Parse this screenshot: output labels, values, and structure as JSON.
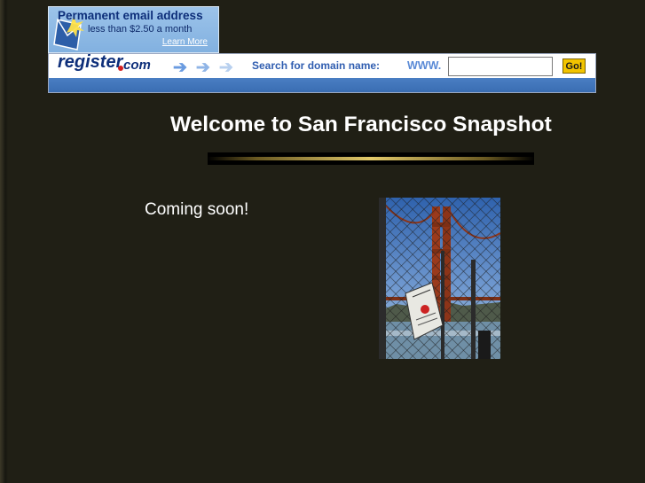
{
  "ad": {
    "title": "Permanent email address",
    "price": "less than $2.50 a month",
    "learn_more": "Learn More",
    "logo_register": "register",
    "logo_com": "com",
    "search_label": "Search for domain name:",
    "www_label": "WWW.",
    "domain_value": "",
    "go_label": "Go!",
    "arrow_glyph": "➔",
    "arrow_colors": [
      "#6a9be0",
      "#8fb4e6",
      "#b8d0ef"
    ]
  },
  "main": {
    "heading": "Welcome to San Francisco Snapshot",
    "status": "Coming soon!"
  },
  "photo": {
    "subject": "Golden Gate Bridge seen through chain-link fence"
  },
  "colors": {
    "page_background": "#201f15",
    "text": "#ffffff",
    "divider_gold": "#e2c96a",
    "ad_blue": "#3a6db2",
    "go_yellow": "#f2c400"
  }
}
